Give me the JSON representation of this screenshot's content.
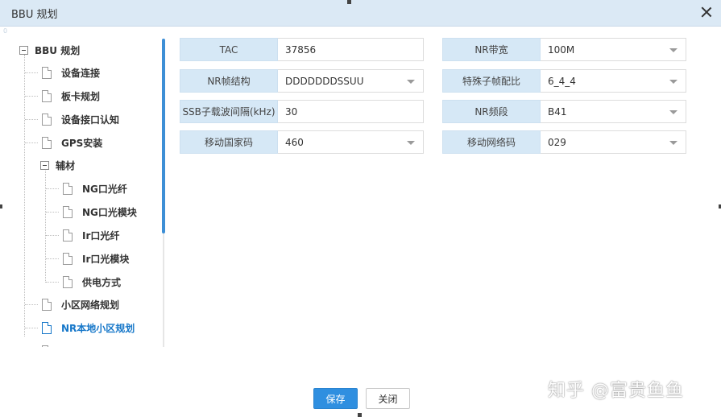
{
  "window": {
    "title": "BBU 规划",
    "scroll_value": "0"
  },
  "tree": {
    "root": "BBU 规划",
    "items": [
      {
        "label": "设备连接"
      },
      {
        "label": "板卡规划"
      },
      {
        "label": "设备接口认知"
      },
      {
        "label": "GPS安装"
      },
      {
        "label": "辅材"
      },
      {
        "label": "NG口光纤"
      },
      {
        "label": "NG口光模块"
      },
      {
        "label": "Ir口光纤"
      },
      {
        "label": "Ir口光模块"
      },
      {
        "label": "供电方式"
      },
      {
        "label": "小区网络规划"
      },
      {
        "label": "NR本地小区规划"
      }
    ]
  },
  "form": {
    "tac": {
      "label": "TAC",
      "value": "37856"
    },
    "nr_bandwidth": {
      "label": "NR带宽",
      "value": "100M"
    },
    "nr_frame_structure": {
      "label": "NR帧结构",
      "value": "DDDDDDDSSUU"
    },
    "special_subframe_ratio": {
      "label": "特殊子帧配比",
      "value": "6_4_4"
    },
    "ssb_subcarrier_spacing": {
      "label": "SSB子载波间隔(kHz)",
      "value": "30"
    },
    "nr_band": {
      "label": "NR频段",
      "value": "B41"
    },
    "mcc": {
      "label": "移动国家码",
      "value": "460"
    },
    "mnc": {
      "label": "移动网络码",
      "value": "029"
    }
  },
  "buttons": {
    "save": "保存",
    "close": "关闭"
  },
  "watermark": "知乎 @富贵鱼鱼"
}
